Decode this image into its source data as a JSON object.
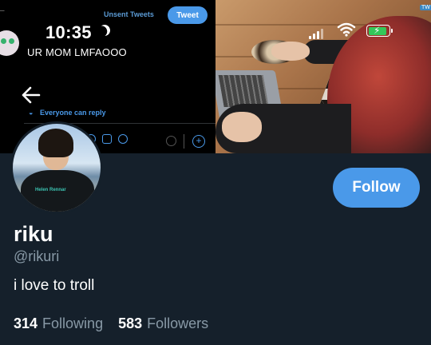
{
  "status_bar": {
    "time": "10:35",
    "battery_level": 0.9,
    "battery_color": "#34c759"
  },
  "banner": {
    "composer": {
      "unsent_label": "Unsent Tweets",
      "tweet_button": "Tweet",
      "tweet_text": "UR MOM LMFAOOO",
      "reply_setting": "Everyone can reply"
    },
    "badge": "TW"
  },
  "profile": {
    "display_name": "riku",
    "handle": "@rikuri",
    "bio": "i love to troll",
    "avatar_shirt_print": "Helen Rennar",
    "follow_button": "Follow",
    "stats": {
      "following_count": "314",
      "following_label": "Following",
      "followers_count": "583",
      "followers_label": "Followers"
    }
  },
  "colors": {
    "background": "#15202b",
    "accent": "#4a99e9",
    "secondary_text": "#8899a6"
  }
}
